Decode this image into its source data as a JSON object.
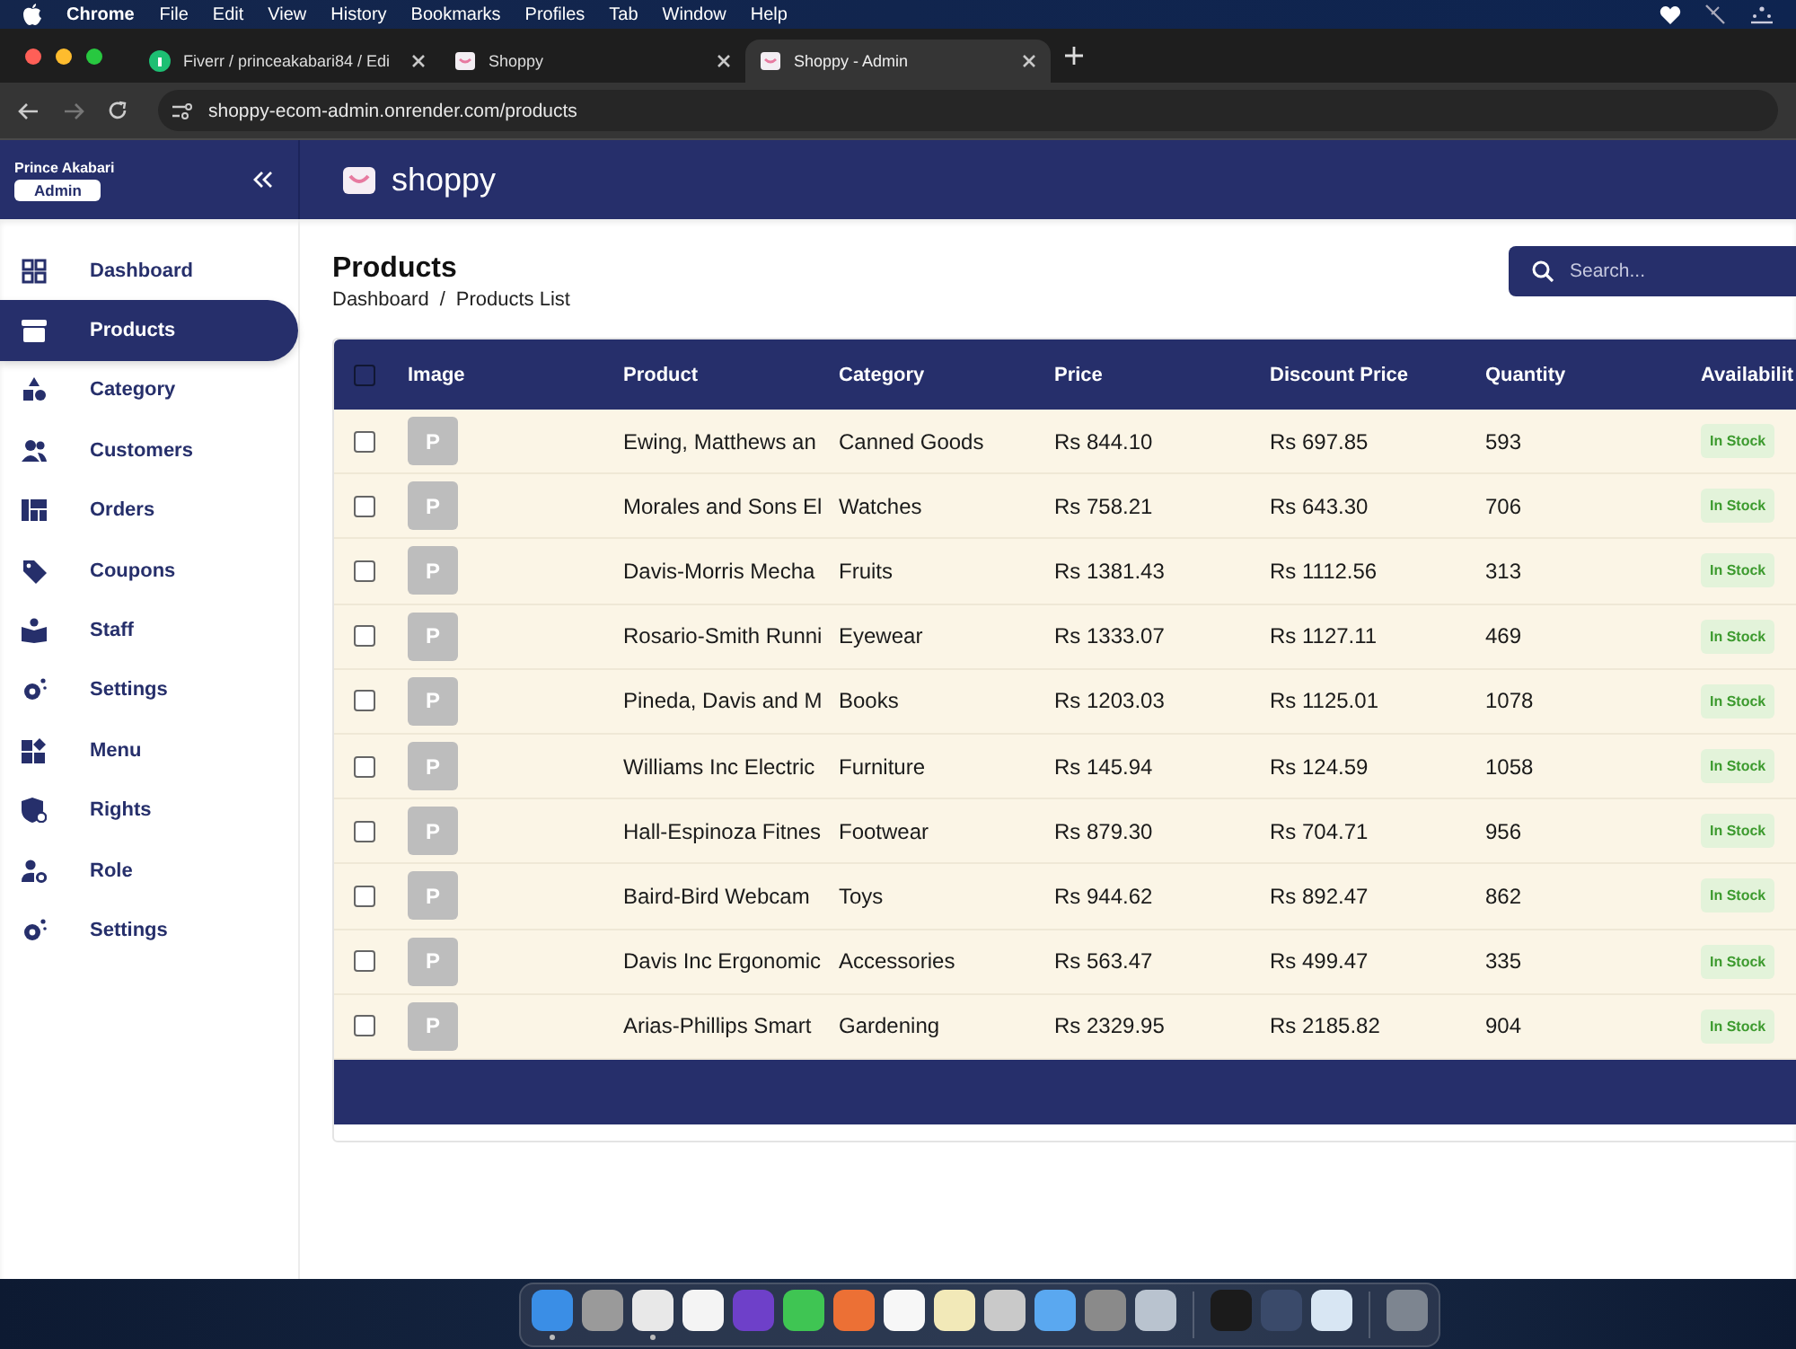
{
  "menu_bar": {
    "app": "Chrome",
    "items": [
      "File",
      "Edit",
      "View",
      "History",
      "Bookmarks",
      "Profiles",
      "Tab",
      "Window",
      "Help"
    ]
  },
  "browser": {
    "tabs": [
      {
        "title": "Fiverr / princeakabari84 / Edi",
        "selected": false
      },
      {
        "title": "Shoppy",
        "selected": false
      },
      {
        "title": "Shoppy - Admin",
        "selected": true
      }
    ],
    "url": "shoppy-ecom-admin.onrender.com/products"
  },
  "app": {
    "user": {
      "name": "Prince Akabari",
      "role": "Admin"
    },
    "logo": "shoppy"
  },
  "sidebar": {
    "items": [
      {
        "label": "Dashboard",
        "selected": false
      },
      {
        "label": "Products",
        "selected": true
      },
      {
        "label": "Category",
        "selected": false
      },
      {
        "label": "Customers",
        "selected": false
      },
      {
        "label": "Orders",
        "selected": false
      },
      {
        "label": "Coupons",
        "selected": false
      },
      {
        "label": "Staff",
        "selected": false
      },
      {
        "label": "Settings",
        "selected": false
      },
      {
        "label": "Menu",
        "selected": false
      },
      {
        "label": "Rights",
        "selected": false
      },
      {
        "label": "Role",
        "selected": false
      },
      {
        "label": "Settings",
        "selected": false
      }
    ]
  },
  "page": {
    "title": "Products",
    "breadcrumb": {
      "items": [
        "Dashboard",
        "Products List"
      ],
      "separator": "/"
    },
    "search": {
      "placeholder": "Search..."
    }
  },
  "table": {
    "header_checked": false,
    "columns": [
      "Image",
      "Product",
      "Category",
      "Price",
      "Discount Price",
      "Quantity",
      "Availabilit"
    ],
    "rows": [
      {
        "checked": false,
        "image": "P",
        "product": "Ewing, Matthews an",
        "category": "Canned Goods",
        "price": "Rs 844.10",
        "discount_price": "Rs 697.85",
        "quantity": "593",
        "availability": "In Stock"
      },
      {
        "checked": false,
        "image": "P",
        "product": "Morales and Sons El",
        "category": "Watches",
        "price": "Rs 758.21",
        "discount_price": "Rs 643.30",
        "quantity": "706",
        "availability": "In Stock"
      },
      {
        "checked": false,
        "image": "P",
        "product": "Davis-Morris Mecha",
        "category": "Fruits",
        "price": "Rs 1381.43",
        "discount_price": "Rs 1112.56",
        "quantity": "313",
        "availability": "In Stock"
      },
      {
        "checked": false,
        "image": "P",
        "product": "Rosario-Smith Runni",
        "category": "Eyewear",
        "price": "Rs 1333.07",
        "discount_price": "Rs 1127.11",
        "quantity": "469",
        "availability": "In Stock"
      },
      {
        "checked": false,
        "image": "P",
        "product": "Pineda, Davis and M",
        "category": "Books",
        "price": "Rs 1203.03",
        "discount_price": "Rs 1125.01",
        "quantity": "1078",
        "availability": "In Stock"
      },
      {
        "checked": false,
        "image": "P",
        "product": "Williams Inc Electric",
        "category": "Furniture",
        "price": "Rs 145.94",
        "discount_price": "Rs 124.59",
        "quantity": "1058",
        "availability": "In Stock"
      },
      {
        "checked": false,
        "image": "P",
        "product": "Hall-Espinoza Fitnes",
        "category": "Footwear",
        "price": "Rs 879.30",
        "discount_price": "Rs 704.71",
        "quantity": "956",
        "availability": "In Stock"
      },
      {
        "checked": false,
        "image": "P",
        "product": "Baird-Bird Webcam",
        "category": "Toys",
        "price": "Rs 944.62",
        "discount_price": "Rs 892.47",
        "quantity": "862",
        "availability": "In Stock"
      },
      {
        "checked": false,
        "image": "P",
        "product": "Davis Inc Ergonomic",
        "category": "Accessories",
        "price": "Rs 563.47",
        "discount_price": "Rs 499.47",
        "quantity": "335",
        "availability": "In Stock"
      },
      {
        "checked": false,
        "image": "P",
        "product": "Arias-Phillips Smart",
        "category": "Gardening",
        "price": "Rs 2329.95",
        "discount_price": "Rs 2185.82",
        "quantity": "904",
        "availability": "In Stock"
      }
    ]
  },
  "dock": {
    "groups": [
      [
        {
          "color": "#3a8ee6",
          "running": true
        },
        {
          "color": "#9a9a9a",
          "running": false
        },
        {
          "color": "#e8e8e8",
          "running": true
        },
        {
          "color": "#f4f4f4",
          "running": false
        },
        {
          "color": "#6e40c9",
          "running": false
        },
        {
          "color": "#3fc553",
          "running": false
        },
        {
          "color": "#ec7035",
          "running": false
        },
        {
          "color": "#f7f7f7",
          "running": false
        },
        {
          "color": "#f2e9b8",
          "running": false
        },
        {
          "color": "#c9c9c9",
          "running": false
        },
        {
          "color": "#5aa8f0",
          "running": false
        },
        {
          "color": "#8a8a8a",
          "running": false
        },
        {
          "color": "#b9c3cf",
          "running": false
        }
      ],
      [
        {
          "color": "#1b1b1b",
          "running": false
        },
        {
          "color": "#3a4a6a",
          "running": false
        },
        {
          "color": "#d8e6f3",
          "running": false
        }
      ],
      [
        {
          "color": "#7d8590",
          "running": false
        }
      ]
    ]
  }
}
